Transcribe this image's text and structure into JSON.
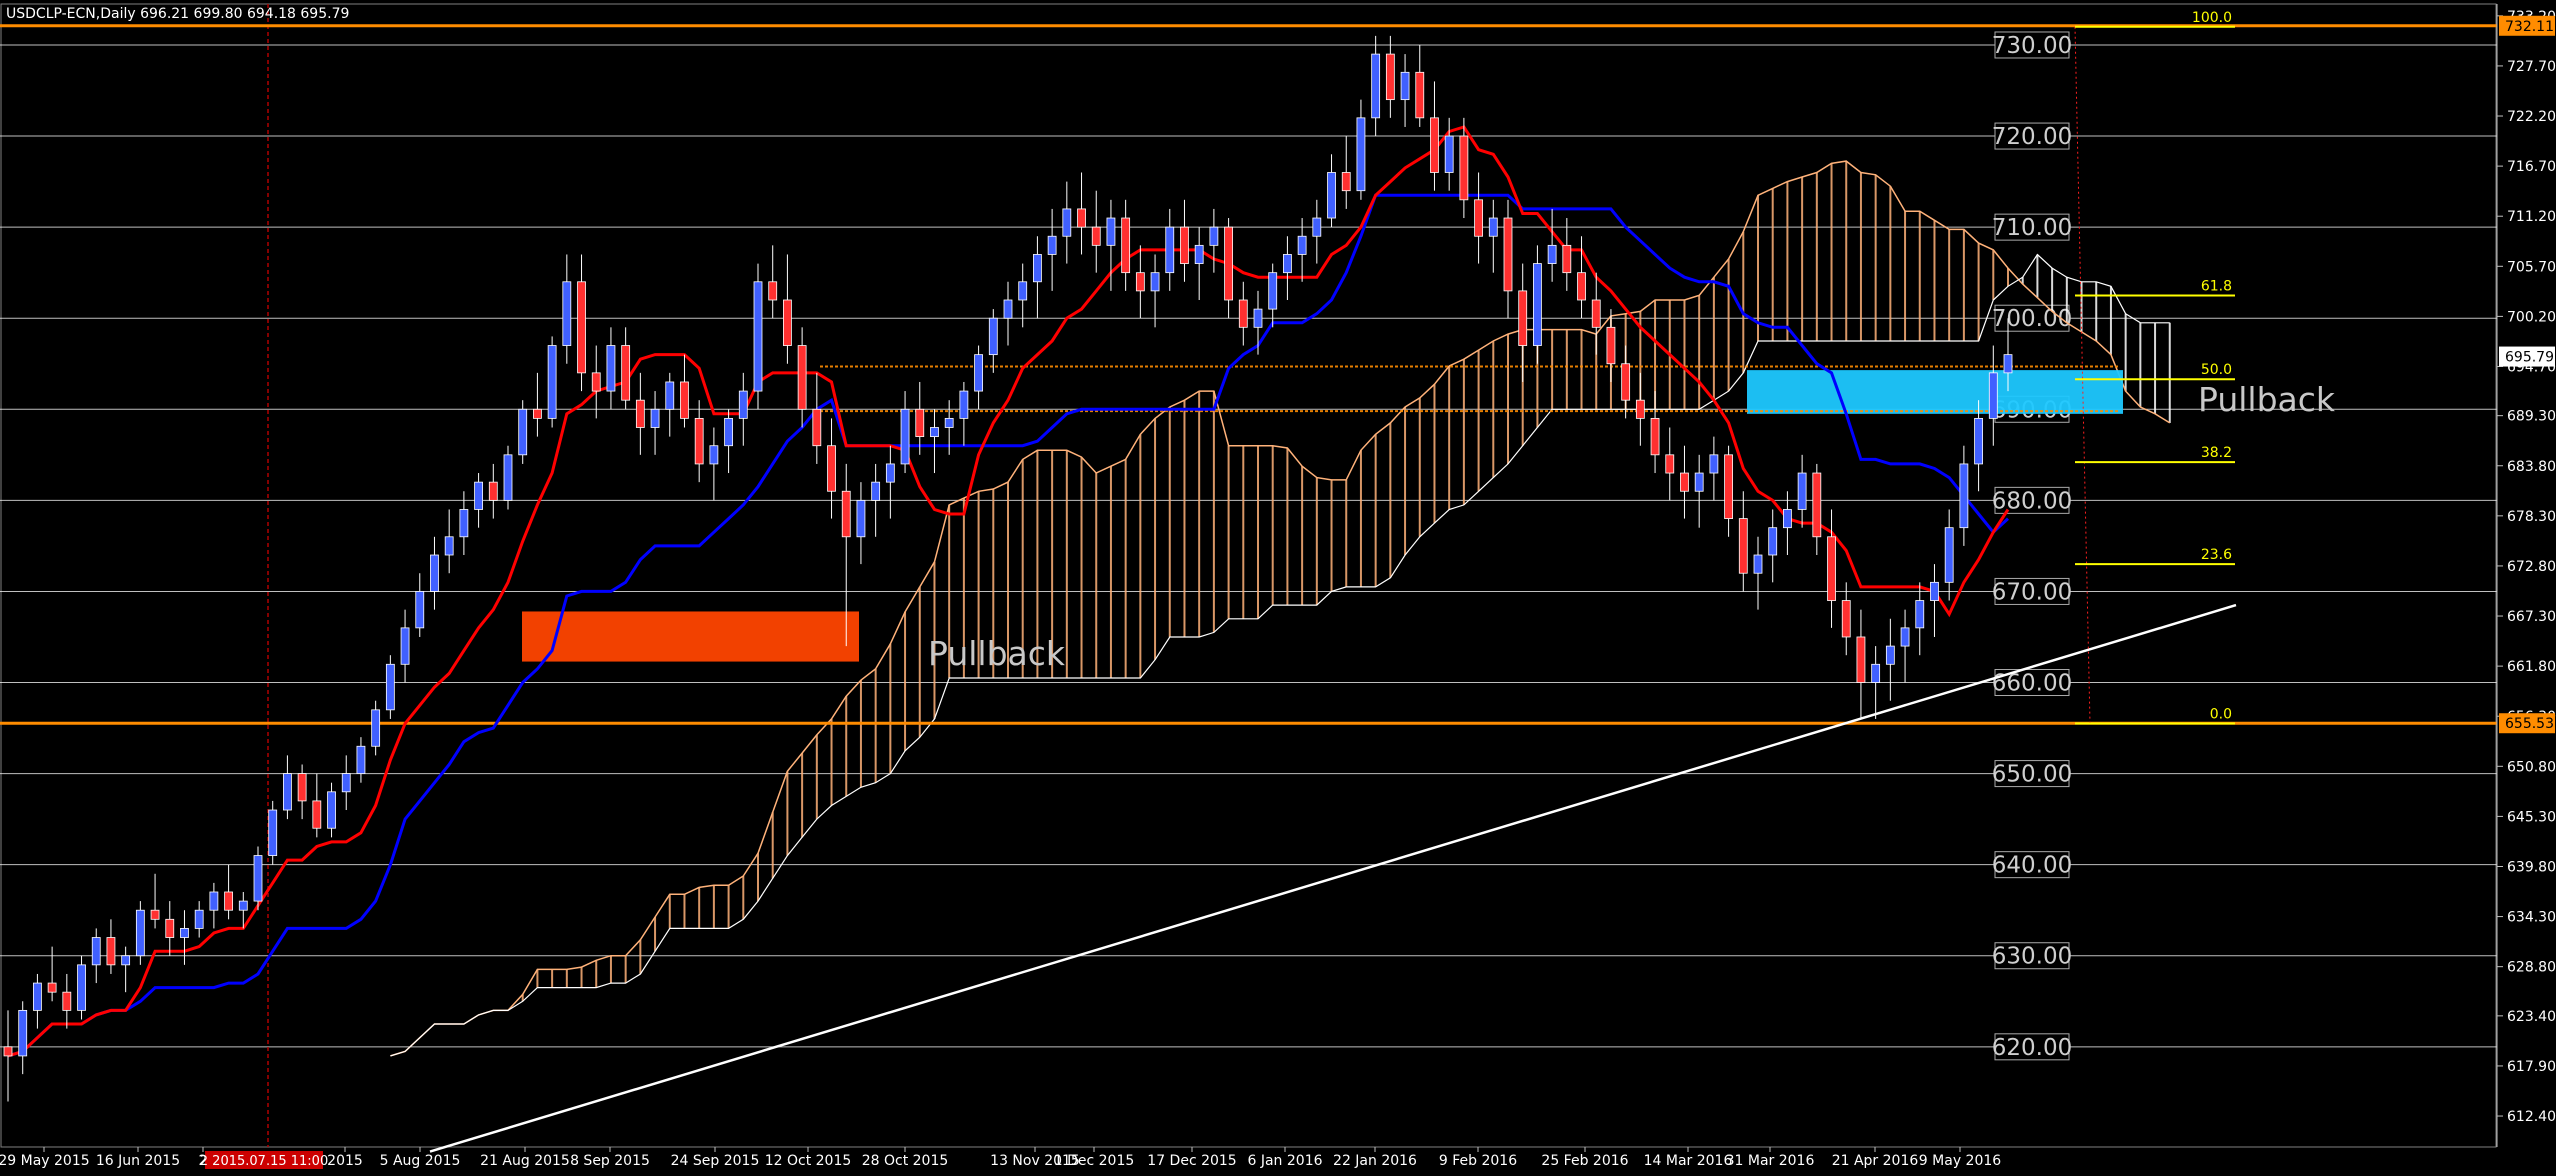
{
  "header": {
    "symbol_line": "USDCLP-ECN,Daily  696.21 699.80 694.18 695.79"
  },
  "annotations": {
    "pullback_left": "Pullback",
    "pullback_right": "Pullback",
    "time_marker_label": "2 2015.07.15 11:00"
  },
  "colors": {
    "background": "#000000",
    "grid": "#ffffff",
    "tenkan": "#ff0000",
    "kijun": "#0000ff",
    "cloud_bull": "#ffb27a",
    "cloud_bear": "#ffffff",
    "level": "#ff8c00",
    "fib": "#ffff00",
    "zone_bear": "#ff4500",
    "zone_bull": "#1ec8ff",
    "candle_up": "#4060ff",
    "candle_down": "#ff3030"
  },
  "chart_data": {
    "type": "candlestick",
    "symbol": "USDCLP-ECN",
    "timeframe": "Daily",
    "ylim": [
      609,
      734.5
    ],
    "y_ticks": [
      "733.20",
      "727.70",
      "722.20",
      "716.70",
      "711.20",
      "705.70",
      "700.20",
      "694.70",
      "689.30",
      "683.80",
      "678.30",
      "672.80",
      "667.30",
      "661.80",
      "656.30",
      "650.80",
      "645.30",
      "639.80",
      "634.30",
      "628.80",
      "623.40",
      "617.90",
      "612.40"
    ],
    "x_ticks": [
      "29 May 2015",
      "16 Jun 2015",
      "2",
      "2015",
      "5 Aug 2015",
      "21 Aug 2015",
      "8 Sep 2015",
      "24 Sep 2015",
      "12 Oct 2015",
      "28 Oct 2015",
      "13 Nov 2015",
      "1 Dec 2015",
      "17 Dec 2015",
      "6 Jan 2016",
      "22 Jan 2016",
      "9 Feb 2016",
      "25 Feb 2016",
      "14 Mar 2016",
      "31 Mar 2016",
      "21 Apr 2016",
      "9 May 2016"
    ],
    "round_levels": [
      "730.00",
      "720.00",
      "710.00",
      "700.00",
      "690.00",
      "680.00",
      "670.00",
      "660.00",
      "650.00",
      "640.00",
      "630.00",
      "620.00"
    ],
    "current_price": "695.79",
    "horizontal_levels": [
      {
        "price": 732.11,
        "label": "732.11"
      },
      {
        "price": 655.53,
        "label": "655.53"
      }
    ],
    "fibonacci": [
      {
        "level": "100.0",
        "price": 732.0
      },
      {
        "level": "61.8",
        "price": 702.5
      },
      {
        "level": "50.0",
        "price": 693.3
      },
      {
        "level": "38.2",
        "price": 684.2
      },
      {
        "level": "23.6",
        "price": 673.0
      },
      {
        "level": "0.0",
        "price": 655.5
      }
    ],
    "zones": [
      {
        "name": "pullback-zone-bear",
        "price_top": 667.8,
        "price_bottom": 662.3
      },
      {
        "name": "pullback-zone-bull",
        "price_top": 694.3,
        "price_bottom": 689.5
      }
    ],
    "trendline": {
      "start": [
        0,
        608.5
      ],
      "end": [
        279,
        668.5
      ]
    },
    "candles": [
      [
        620,
        624,
        614,
        619
      ],
      [
        619,
        625,
        617,
        624
      ],
      [
        624,
        628,
        622,
        627
      ],
      [
        627,
        631,
        625,
        626
      ],
      [
        626,
        628,
        622,
        624
      ],
      [
        624,
        630,
        623,
        629
      ],
      [
        629,
        633,
        627,
        632
      ],
      [
        632,
        634,
        628,
        629
      ],
      [
        629,
        631,
        626,
        630
      ],
      [
        630,
        636,
        629,
        635
      ],
      [
        635,
        639,
        633,
        634
      ],
      [
        634,
        636,
        630,
        632
      ],
      [
        632,
        635,
        629,
        633
      ],
      [
        633,
        636,
        632,
        635
      ],
      [
        635,
        638,
        633,
        637
      ],
      [
        637,
        640,
        634,
        635
      ],
      [
        635,
        637,
        633,
        636
      ],
      [
        636,
        642,
        635,
        641
      ],
      [
        641,
        647,
        640,
        646
      ],
      [
        646,
        652,
        645,
        650
      ],
      [
        650,
        651,
        645,
        647
      ],
      [
        647,
        650,
        643,
        644
      ],
      [
        644,
        649,
        643,
        648
      ],
      [
        648,
        652,
        646,
        650
      ],
      [
        650,
        654,
        649,
        653
      ],
      [
        653,
        658,
        652,
        657
      ],
      [
        657,
        663,
        656,
        662
      ],
      [
        662,
        668,
        660,
        666
      ],
      [
        666,
        672,
        665,
        670
      ],
      [
        670,
        676,
        668,
        674
      ],
      [
        674,
        679,
        672,
        676
      ],
      [
        676,
        681,
        674,
        679
      ],
      [
        679,
        683,
        677,
        682
      ],
      [
        682,
        684,
        678,
        680
      ],
      [
        680,
        686,
        679,
        685
      ],
      [
        685,
        691,
        684,
        690
      ],
      [
        690,
        694,
        687,
        689
      ],
      [
        689,
        698,
        688,
        697
      ],
      [
        697,
        707,
        695,
        704
      ],
      [
        704,
        707,
        692,
        694
      ],
      [
        694,
        697,
        689,
        692
      ],
      [
        692,
        699,
        690,
        697
      ],
      [
        697,
        699,
        690,
        691
      ],
      [
        691,
        694,
        685,
        688
      ],
      [
        688,
        692,
        685,
        690
      ],
      [
        690,
        694,
        687,
        693
      ],
      [
        693,
        696,
        688,
        689
      ],
      [
        689,
        691,
        682,
        684
      ],
      [
        684,
        688,
        680,
        686
      ],
      [
        686,
        690,
        683,
        689
      ],
      [
        689,
        694,
        686,
        692
      ],
      [
        692,
        706,
        690,
        704
      ],
      [
        704,
        708,
        700,
        702
      ],
      [
        702,
        707,
        695,
        697
      ],
      [
        697,
        699,
        688,
        690
      ],
      [
        690,
        694,
        684,
        686
      ],
      [
        686,
        689,
        678,
        681
      ],
      [
        681,
        684,
        664,
        676
      ],
      [
        676,
        682,
        673,
        680
      ],
      [
        680,
        684,
        676,
        682
      ],
      [
        682,
        686,
        678,
        684
      ],
      [
        684,
        692,
        683,
        690
      ],
      [
        690,
        693,
        685,
        687
      ],
      [
        687,
        690,
        683,
        688
      ],
      [
        688,
        691,
        685,
        689
      ],
      [
        689,
        693,
        686,
        692
      ],
      [
        692,
        697,
        690,
        696
      ],
      [
        696,
        701,
        694,
        700
      ],
      [
        700,
        704,
        697,
        702
      ],
      [
        702,
        706,
        699,
        704
      ],
      [
        704,
        709,
        700,
        707
      ],
      [
        707,
        712,
        703,
        709
      ],
      [
        709,
        715,
        706,
        712
      ],
      [
        712,
        716,
        707,
        710
      ],
      [
        710,
        714,
        705,
        708
      ],
      [
        708,
        713,
        703,
        711
      ],
      [
        711,
        713,
        703,
        705
      ],
      [
        705,
        708,
        700,
        703
      ],
      [
        703,
        707,
        699,
        705
      ],
      [
        705,
        712,
        703,
        710
      ],
      [
        710,
        713,
        704,
        706
      ],
      [
        706,
        710,
        702,
        708
      ],
      [
        708,
        712,
        705,
        710
      ],
      [
        710,
        711,
        700,
        702
      ],
      [
        702,
        704,
        697,
        699
      ],
      [
        699,
        703,
        696,
        701
      ],
      [
        701,
        706,
        699,
        705
      ],
      [
        705,
        709,
        702,
        707
      ],
      [
        707,
        711,
        704,
        709
      ],
      [
        709,
        713,
        706,
        711
      ],
      [
        711,
        718,
        710,
        716
      ],
      [
        716,
        720,
        712,
        714
      ],
      [
        714,
        724,
        713,
        722
      ],
      [
        722,
        731,
        720,
        729
      ],
      [
        729,
        731,
        722,
        724
      ],
      [
        724,
        729,
        721,
        727
      ],
      [
        727,
        730,
        721,
        722
      ],
      [
        722,
        726,
        714,
        716
      ],
      [
        716,
        722,
        714,
        720
      ],
      [
        720,
        722,
        711,
        713
      ],
      [
        713,
        716,
        706,
        709
      ],
      [
        709,
        713,
        705,
        711
      ],
      [
        711,
        713,
        700,
        703
      ],
      [
        703,
        706,
        693,
        697
      ],
      [
        697,
        708,
        695,
        706
      ],
      [
        706,
        712,
        704,
        708
      ],
      [
        708,
        711,
        703,
        705
      ],
      [
        705,
        709,
        700,
        702
      ],
      [
        702,
        705,
        696,
        699
      ],
      [
        699,
        701,
        693,
        695
      ],
      [
        695,
        697,
        689,
        691
      ],
      [
        691,
        694,
        686,
        689
      ],
      [
        689,
        692,
        683,
        685
      ],
      [
        685,
        688,
        680,
        683
      ],
      [
        683,
        686,
        678,
        681
      ],
      [
        681,
        685,
        677,
        683
      ],
      [
        683,
        687,
        680,
        685
      ],
      [
        685,
        686,
        676,
        678
      ],
      [
        678,
        681,
        670,
        672
      ],
      [
        672,
        676,
        668,
        674
      ],
      [
        674,
        679,
        671,
        677
      ],
      [
        677,
        681,
        674,
        679
      ],
      [
        679,
        685,
        677,
        683
      ],
      [
        683,
        684,
        674,
        676
      ],
      [
        676,
        679,
        666,
        669
      ],
      [
        669,
        671,
        663,
        665
      ],
      [
        665,
        668,
        656,
        660
      ],
      [
        660,
        664,
        656,
        662
      ],
      [
        662,
        667,
        658,
        664
      ],
      [
        664,
        668,
        660,
        666
      ],
      [
        666,
        671,
        663,
        669
      ],
      [
        669,
        673,
        665,
        671
      ],
      [
        671,
        679,
        669,
        677
      ],
      [
        677,
        686,
        675,
        684
      ],
      [
        684,
        691,
        681,
        689
      ],
      [
        689,
        697,
        686,
        694
      ],
      [
        694,
        700,
        692,
        696
      ]
    ]
  }
}
